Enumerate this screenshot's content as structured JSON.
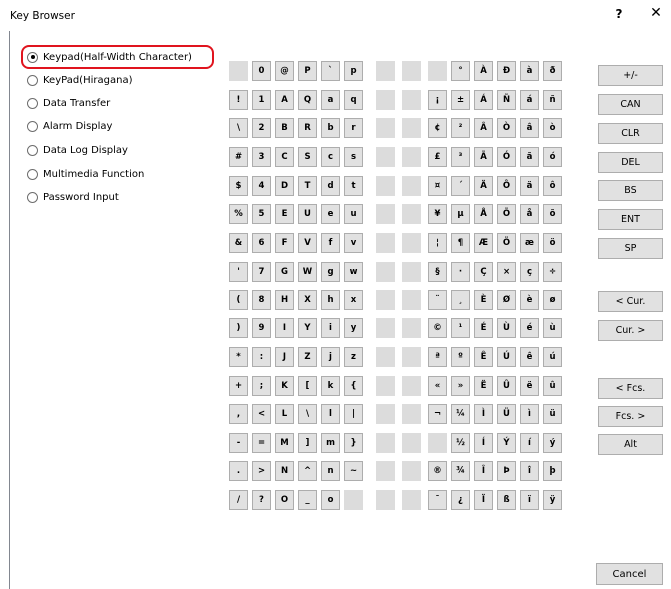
{
  "window": {
    "title": "Key Browser",
    "help": "?",
    "close": "✕"
  },
  "options": [
    {
      "label": "Keypad(Half-Width Character)",
      "checked": true
    },
    {
      "label": "KeyPad(Hiragana)",
      "checked": false
    },
    {
      "label": "Data Transfer",
      "checked": false
    },
    {
      "label": "Alarm Display",
      "checked": false
    },
    {
      "label": "Data Log Display",
      "checked": false
    },
    {
      "label": "Multimedia Function",
      "checked": false
    },
    {
      "label": "Password Input",
      "checked": false
    }
  ],
  "keys": [
    [
      "",
      "0",
      "@",
      "P",
      "`",
      "p",
      "",
      "",
      "",
      "°",
      "À",
      "Ð",
      "à",
      "ð"
    ],
    [
      "!",
      "1",
      "A",
      "Q",
      "a",
      "q",
      "",
      "",
      "¡",
      "±",
      "Á",
      "Ñ",
      "á",
      "ñ"
    ],
    [
      "\\",
      "2",
      "B",
      "R",
      "b",
      "r",
      "",
      "",
      "¢",
      "²",
      "Â",
      "Ò",
      "â",
      "ò"
    ],
    [
      "#",
      "3",
      "C",
      "S",
      "c",
      "s",
      "",
      "",
      "£",
      "³",
      "Ã",
      "Ó",
      "ã",
      "ó"
    ],
    [
      "$",
      "4",
      "D",
      "T",
      "d",
      "t",
      "",
      "",
      "¤",
      "´",
      "Ä",
      "Ô",
      "ä",
      "ô"
    ],
    [
      "%",
      "5",
      "E",
      "U",
      "e",
      "u",
      "",
      "",
      "¥",
      "µ",
      "Å",
      "Õ",
      "å",
      "õ"
    ],
    [
      "&",
      "6",
      "F",
      "V",
      "f",
      "v",
      "",
      "",
      "¦",
      "¶",
      "Æ",
      "Ö",
      "æ",
      "ö"
    ],
    [
      "'",
      "7",
      "G",
      "W",
      "g",
      "w",
      "",
      "",
      "§",
      "·",
      "Ç",
      "×",
      "ç",
      "÷"
    ],
    [
      "(",
      "8",
      "H",
      "X",
      "h",
      "x",
      "",
      "",
      "¨",
      "¸",
      "È",
      "Ø",
      "è",
      "ø"
    ],
    [
      ")",
      "9",
      "I",
      "Y",
      "i",
      "y",
      "",
      "",
      "©",
      "¹",
      "É",
      "Ù",
      "é",
      "ù"
    ],
    [
      "*",
      ":",
      "J",
      "Z",
      "j",
      "z",
      "",
      "",
      "ª",
      "º",
      "Ê",
      "Ú",
      "ê",
      "ú"
    ],
    [
      "+",
      ";",
      "K",
      "[",
      "k",
      "{",
      "",
      "",
      "«",
      "»",
      "Ë",
      "Û",
      "ë",
      "û"
    ],
    [
      ",",
      "<",
      "L",
      "\\",
      "l",
      "|",
      "",
      "",
      "¬",
      "¼",
      "Ì",
      "Ü",
      "ì",
      "ü"
    ],
    [
      "-",
      "=",
      "M",
      "]",
      "m",
      "}",
      "",
      "",
      "",
      "½",
      "Í",
      "Ý",
      "í",
      "ý"
    ],
    [
      ".",
      ">",
      "N",
      "^",
      "n",
      "~",
      "",
      "",
      "®",
      "¾",
      "Î",
      "Þ",
      "î",
      "þ"
    ],
    [
      "/",
      "?",
      "O",
      "_",
      "o",
      "",
      "",
      "",
      "¯",
      "¿",
      "Ï",
      "ß",
      "ï",
      "ÿ"
    ]
  ],
  "side_buttons": [
    "+/-",
    "CAN",
    "CLR",
    "DEL",
    "BS",
    "ENT",
    "SP",
    "< Cur.",
    "Cur. >",
    "< Fcs.",
    "Fcs. >",
    "Alt"
  ],
  "cancel_label": "Cancel"
}
